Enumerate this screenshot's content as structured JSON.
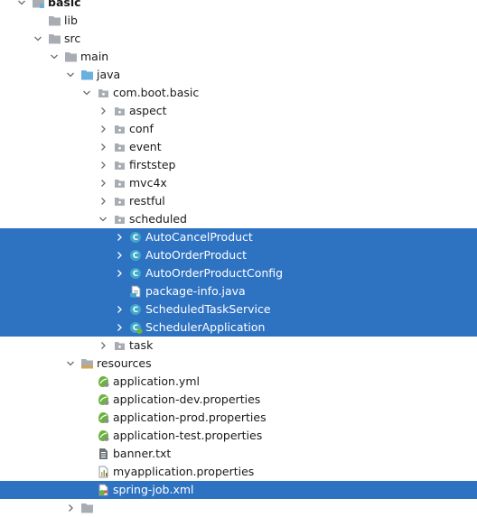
{
  "tree": {
    "rows": [
      {
        "label": "basic",
        "indent": 0,
        "expand": "open",
        "icon": "module-folder-icon",
        "selected": false,
        "bold": true
      },
      {
        "label": "lib",
        "indent": 1,
        "expand": "none",
        "icon": "folder-icon",
        "selected": false
      },
      {
        "label": "src",
        "indent": 1,
        "expand": "open",
        "icon": "folder-icon",
        "selected": false
      },
      {
        "label": "main",
        "indent": 2,
        "expand": "open",
        "icon": "folder-icon",
        "selected": false
      },
      {
        "label": "java",
        "indent": 3,
        "expand": "open",
        "icon": "source-folder-icon",
        "selected": false
      },
      {
        "label": "com.boot.basic",
        "indent": 4,
        "expand": "open",
        "icon": "package-icon",
        "selected": false
      },
      {
        "label": "aspect",
        "indent": 5,
        "expand": "closed",
        "icon": "package-icon",
        "selected": false
      },
      {
        "label": "conf",
        "indent": 5,
        "expand": "closed",
        "icon": "package-icon",
        "selected": false
      },
      {
        "label": "event",
        "indent": 5,
        "expand": "closed",
        "icon": "package-icon",
        "selected": false
      },
      {
        "label": "firststep",
        "indent": 5,
        "expand": "closed",
        "icon": "package-icon",
        "selected": false
      },
      {
        "label": "mvc4x",
        "indent": 5,
        "expand": "closed",
        "icon": "package-icon",
        "selected": false
      },
      {
        "label": "restful",
        "indent": 5,
        "expand": "closed",
        "icon": "package-icon",
        "selected": false
      },
      {
        "label": "scheduled",
        "indent": 5,
        "expand": "open",
        "icon": "package-icon",
        "selected": false
      },
      {
        "label": "AutoCancelProduct",
        "indent": 6,
        "expand": "closed",
        "icon": "class-icon",
        "selected": true
      },
      {
        "label": "AutoOrderProduct",
        "indent": 6,
        "expand": "closed",
        "icon": "class-icon",
        "selected": true
      },
      {
        "label": "AutoOrderProductConfig",
        "indent": 6,
        "expand": "closed",
        "icon": "class-icon",
        "selected": true
      },
      {
        "label": "package-info.java",
        "indent": 6,
        "expand": "none",
        "icon": "java-file-icon",
        "selected": true
      },
      {
        "label": "ScheduledTaskService",
        "indent": 6,
        "expand": "closed",
        "icon": "class-icon",
        "selected": true
      },
      {
        "label": "SchedulerApplication",
        "indent": 6,
        "expand": "closed",
        "icon": "spring-class-icon",
        "selected": true
      },
      {
        "label": "task",
        "indent": 5,
        "expand": "closed",
        "icon": "package-icon",
        "selected": false
      },
      {
        "label": "resources",
        "indent": 3,
        "expand": "open",
        "icon": "resources-folder-icon",
        "selected": false
      },
      {
        "label": "application.yml",
        "indent": 4,
        "expand": "none",
        "icon": "spring-config-icon",
        "selected": false
      },
      {
        "label": "application-dev.properties",
        "indent": 4,
        "expand": "none",
        "icon": "spring-config-icon",
        "selected": false
      },
      {
        "label": "application-prod.properties",
        "indent": 4,
        "expand": "none",
        "icon": "spring-config-icon",
        "selected": false
      },
      {
        "label": "application-test.properties",
        "indent": 4,
        "expand": "none",
        "icon": "spring-config-icon",
        "selected": false
      },
      {
        "label": "banner.txt",
        "indent": 4,
        "expand": "none",
        "icon": "text-file-icon",
        "selected": false
      },
      {
        "label": "myapplication.properties",
        "indent": 4,
        "expand": "none",
        "icon": "properties-file-icon",
        "selected": false
      },
      {
        "label": "spring-job.xml",
        "indent": 4,
        "expand": "none",
        "icon": "xml-file-icon",
        "selected": true
      },
      {
        "label": "",
        "indent": 3,
        "expand": "closed",
        "icon": "folder-icon",
        "selected": false
      }
    ]
  },
  "colors": {
    "selection": "#2e72c2",
    "folder": "#a8adb3",
    "source_folder": "#6ab0de",
    "class_icon": "#3fa7c9",
    "spring_green": "#6db33f"
  }
}
